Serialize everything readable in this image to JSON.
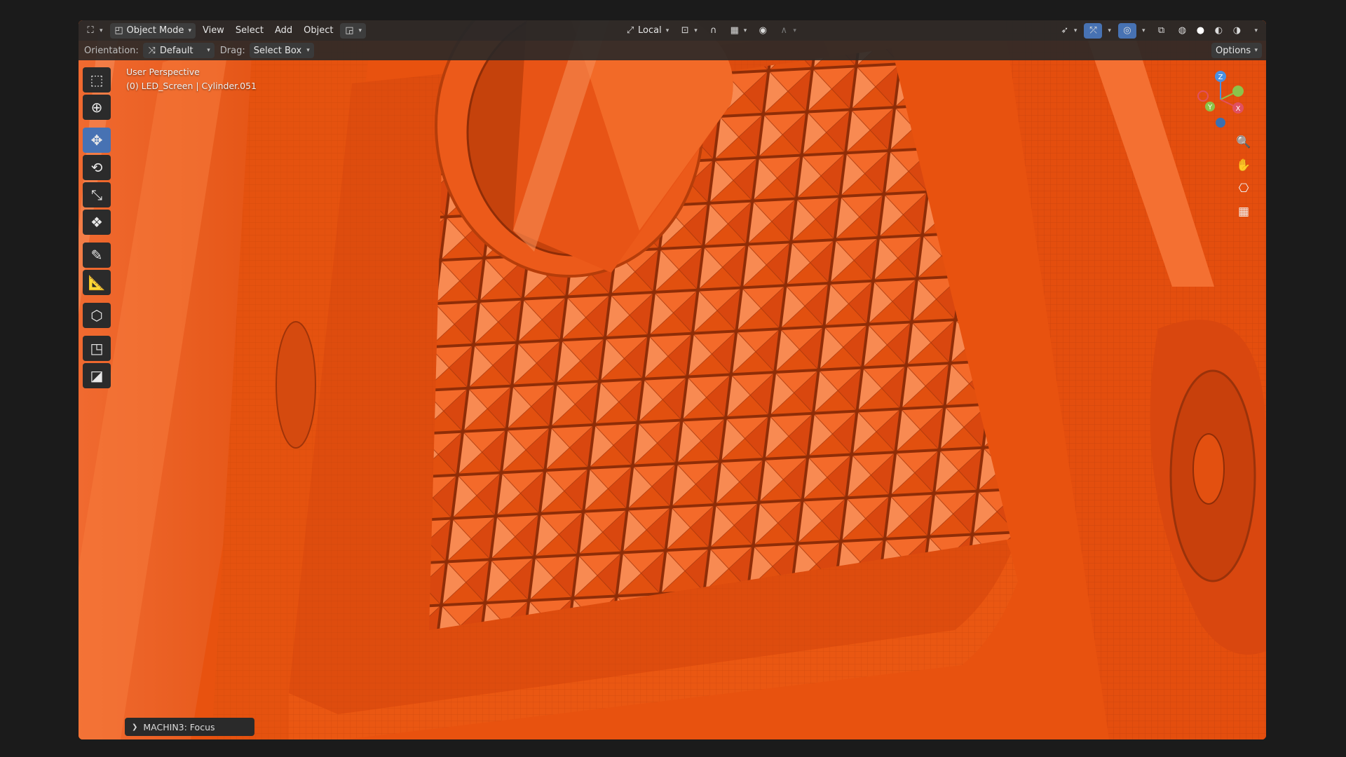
{
  "header": {
    "editor_type_icon": "view3d-icon",
    "mode": "Object Mode",
    "menus": [
      "View",
      "Select",
      "Add",
      "Object"
    ],
    "transform_space": "Local",
    "options_label": "Options"
  },
  "tool_settings": {
    "orientation_label": "Orientation:",
    "orientation_value": "Default",
    "drag_label": "Drag:",
    "drag_value": "Select Box"
  },
  "viewport": {
    "view_name": "User Perspective",
    "object_info": "(0) LED_Screen | Cylinder.051",
    "background_color": "#e8500f"
  },
  "toolbar": {
    "tools": [
      {
        "name": "select-box-icon",
        "active": false
      },
      {
        "name": "cursor-icon",
        "active": false
      },
      {
        "name": "move-icon",
        "active": true
      },
      {
        "name": "rotate-icon",
        "active": false
      },
      {
        "name": "scale-icon",
        "active": false
      },
      {
        "name": "transform-icon",
        "active": false
      },
      {
        "name": "annotate-icon",
        "active": false
      },
      {
        "name": "measure-icon",
        "active": false
      },
      {
        "name": "add-cube-icon",
        "active": false
      },
      {
        "name": "hyper-cursor-icon",
        "active": false
      },
      {
        "name": "boolean-icon",
        "active": false
      }
    ]
  },
  "gizmo": {
    "axes": [
      "X",
      "Y",
      "Z"
    ],
    "colors": {
      "x": "#e05060",
      "y": "#8bc34a",
      "z": "#4a90e2"
    }
  },
  "operator_panel": {
    "label": "MACHIN3: Focus"
  }
}
